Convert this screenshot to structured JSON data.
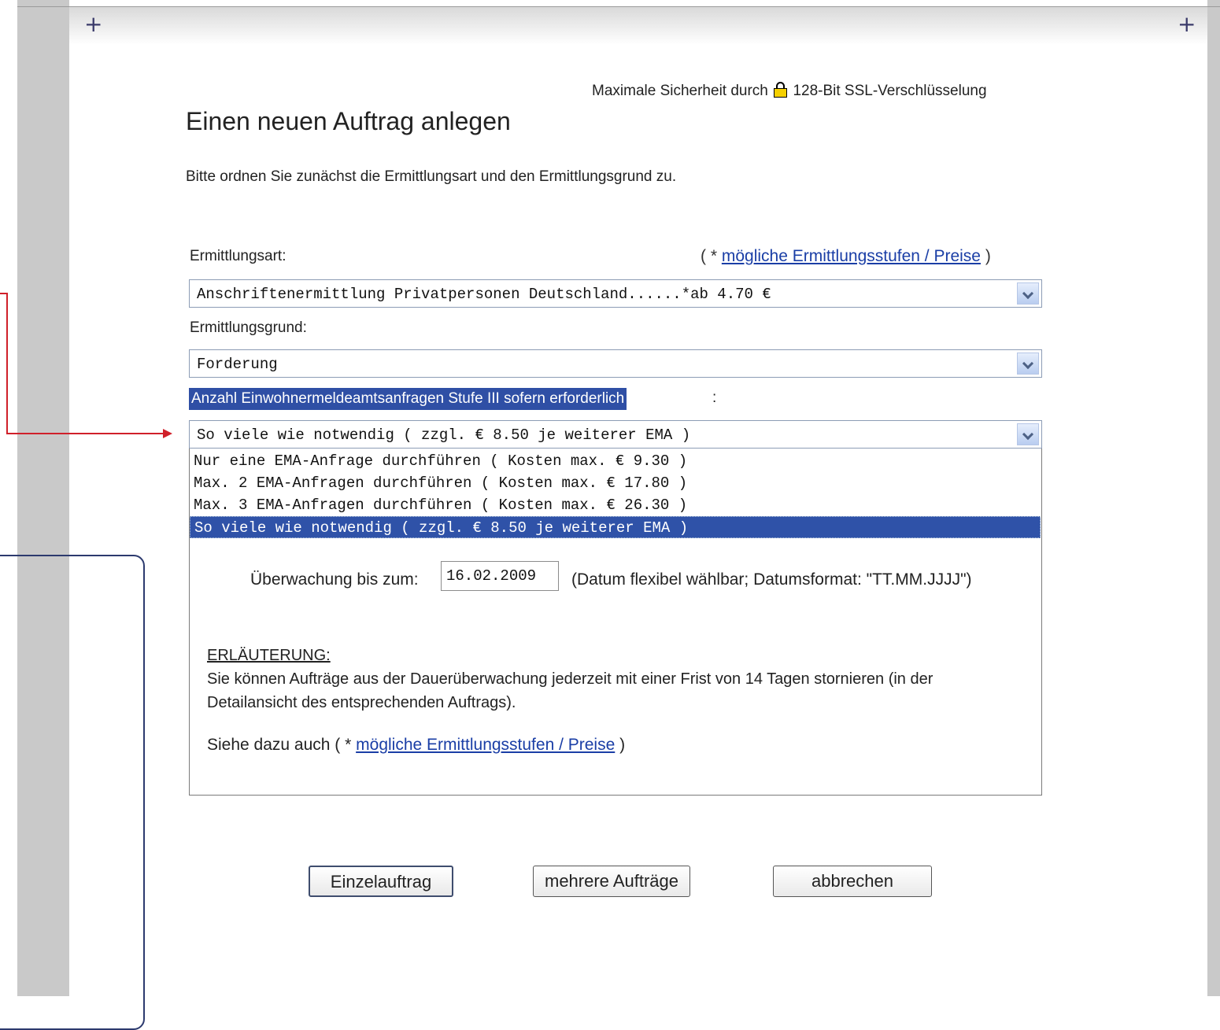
{
  "header": {
    "ssl_prefix": "Maximale Sicherheit durch",
    "ssl_suffix": "128-Bit SSL-Verschlüsselung",
    "lock_icon": "lock-icon"
  },
  "page": {
    "title": "Einen neuen Auftrag anlegen",
    "intro": "Bitte ordnen Sie zunächst die Ermittlungsart und den Ermittlungsgrund zu."
  },
  "form": {
    "ermittlungsart_label": "Ermittlungsart:",
    "prices_prefix": "( *",
    "prices_link": "mögliche Ermittlungsstufen / Preise",
    "prices_suffix": ")",
    "ermittlungsart_value": "Anschriftenermittlung Privatpersonen Deutschland......*ab 4.70 €",
    "ermittlungsgrund_label": "Ermittlungsgrund:",
    "ermittlungsgrund_value": "Forderung",
    "ema_label": "Anzahl Einwohnermeldeamtsanfragen Stufe III sofern erforderlich",
    "ema_colon": ":",
    "ema_value": "So viele wie notwendig ( zzgl. € 8.50 je weiterer EMA )",
    "ema_options": [
      "Nur eine EMA-Anfrage durchführen ( Kosten max. € 9.30 )",
      "Max. 2 EMA-Anfragen durchführen ( Kosten max. € 17.80 )",
      "Max. 3 EMA-Anfragen durchführen ( Kosten max. € 26.30 )",
      "So viele wie notwendig ( zzgl. € 8.50 je weiterer EMA )"
    ],
    "ema_selected_index": 3,
    "watch_label": "Überwachung bis zum:",
    "watch_date": "16.02.2009",
    "watch_hint": "(Datum flexibel wählbar; Datumsformat: \"TT.MM.JJJJ\")",
    "explanation_title": "ERLÄUTERUNG:",
    "explanation_text": "Sie können Aufträge aus der Dauerüberwachung jederzeit mit einer Frist von 14 Tagen stornieren (in der Detailansicht des entsprechenden Auftrags).",
    "see_also_prefix": "Siehe dazu auch ( *",
    "see_also_link": "mögliche Ermittlungsstufen / Preise",
    "see_also_suffix": ")"
  },
  "buttons": {
    "single": "Einzelauftrag",
    "multiple": "mehrere Aufträge",
    "cancel": "abbrechen"
  },
  "colors": {
    "highlight": "#2f4fa5",
    "link": "#1a3ea6",
    "annotation_arrow": "#d0202a",
    "annotation_box": "#2c3a6e"
  }
}
